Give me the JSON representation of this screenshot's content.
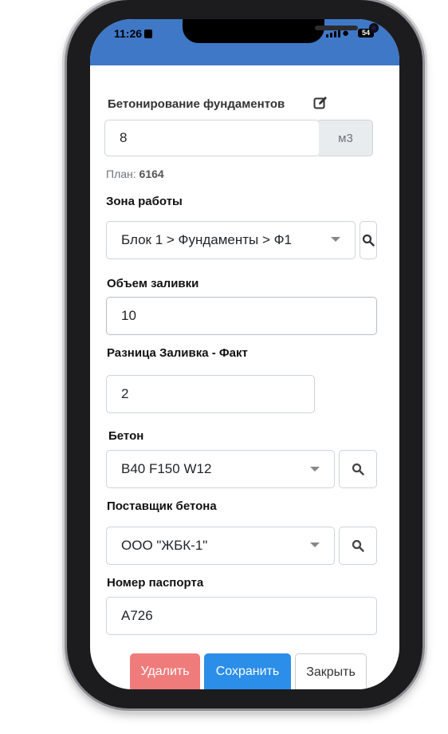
{
  "status": {
    "time": "11:26",
    "battery": "54"
  },
  "form": {
    "title": "Бетонирование фундаментов",
    "quantity_value": "8",
    "quantity_unit": "м3",
    "plan_label": "План:",
    "plan_value": "6164",
    "zone_label": "Зона работы",
    "zone_value": "Блок 1 > Фундаменты > Ф1",
    "pour_label": "Объем заливки",
    "pour_value": "10",
    "diff_label": "Разница Заливка - Факт",
    "diff_value": "2",
    "concrete_label": "Бетон",
    "concrete_value": "B40 F150 W12",
    "supplier_label": "Поставщик бетона",
    "supplier_value": "ООО \"ЖБК-1\"",
    "passport_label": "Номер паспорта",
    "passport_value": "A726"
  },
  "actions": {
    "delete": "Удалить",
    "save": "Сохранить",
    "close": "Закрыть"
  },
  "colors": {
    "header": "#3f78c7",
    "delete": "#ef7b7b",
    "save": "#2b8ee8"
  }
}
